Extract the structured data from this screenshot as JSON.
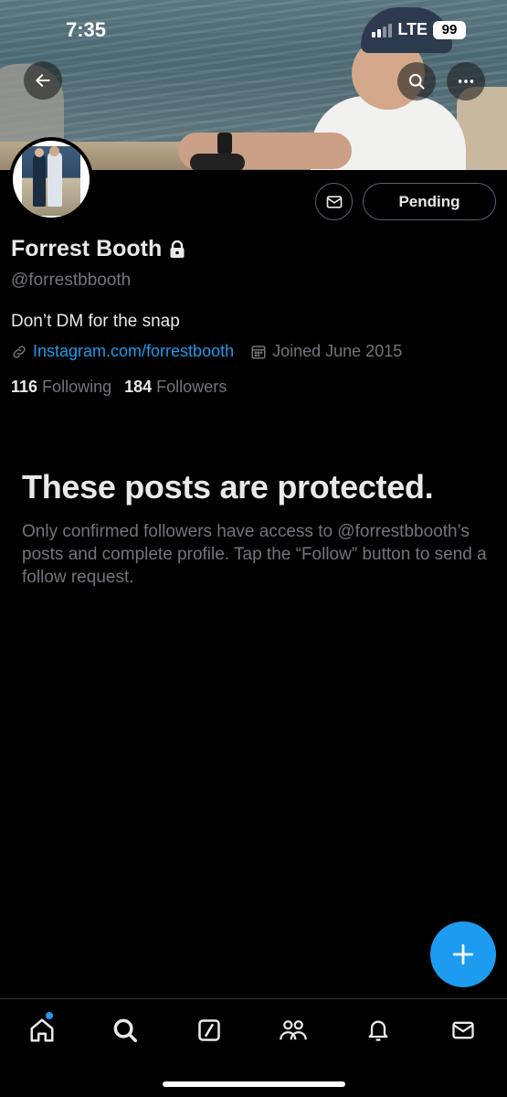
{
  "status_bar": {
    "time": "7:35",
    "network": "LTE",
    "battery": "99"
  },
  "header": {
    "back_icon": "arrow-left-icon",
    "search_icon": "search-icon",
    "more_icon": "more-icon"
  },
  "profile": {
    "name": "Forrest Booth",
    "handle": "@forrestbbooth",
    "bio": "Don’t DM for the snap",
    "link": "Instagram.com/forrestbooth",
    "joined": "Joined June 2015",
    "following_count": "116",
    "following_label": "Following",
    "followers_count": "184",
    "followers_label": "Followers"
  },
  "actions": {
    "pending_label": "Pending"
  },
  "protected": {
    "title": "These posts are protected.",
    "body": "Only confirmed followers have access to @forrestbbooth’s posts and complete profile. Tap the “Follow” button to send a follow request."
  },
  "colors": {
    "accent": "#1d9bf0",
    "muted": "#71767b",
    "text": "#e7e9ea",
    "background": "#000000"
  },
  "nav": [
    {
      "name": "home",
      "icon": "home-icon",
      "notification_dot": true
    },
    {
      "name": "search",
      "icon": "search-icon"
    },
    {
      "name": "grok",
      "icon": "slash-square-icon"
    },
    {
      "name": "communities",
      "icon": "people-icon"
    },
    {
      "name": "notifications",
      "icon": "bell-icon"
    },
    {
      "name": "messages",
      "icon": "envelope-icon"
    }
  ]
}
